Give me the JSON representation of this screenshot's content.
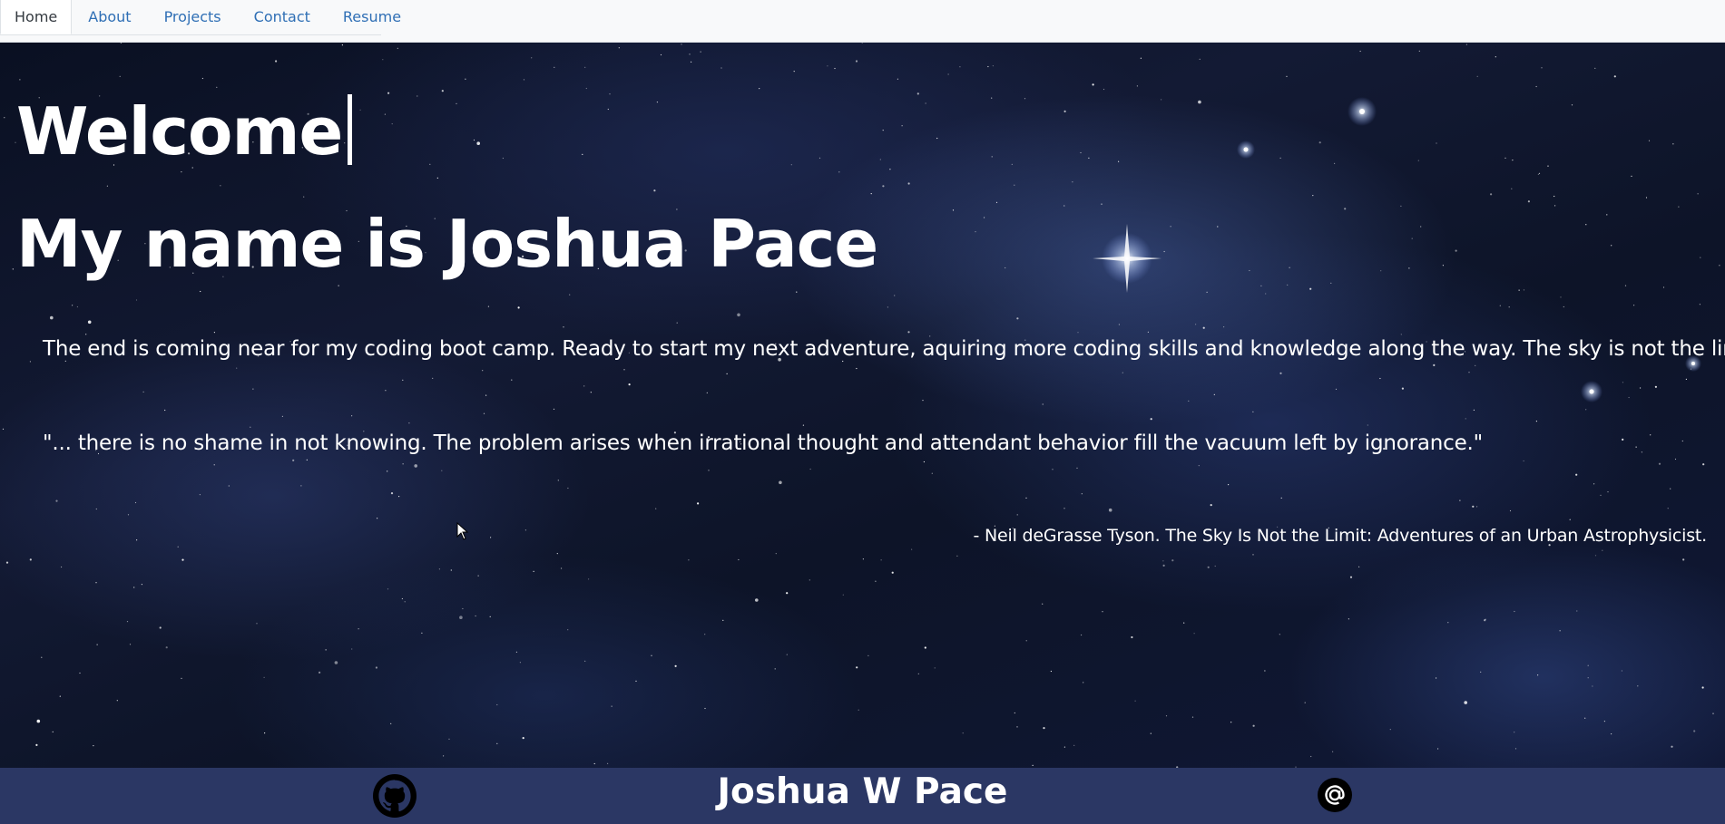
{
  "nav": {
    "tabs": [
      {
        "label": "Home",
        "active": true
      },
      {
        "label": "About"
      },
      {
        "label": "Projects"
      },
      {
        "label": "Contact"
      },
      {
        "label": "Resume"
      }
    ]
  },
  "hero": {
    "welcome": "Welcome",
    "name_heading": "My name is Joshua Pace",
    "intro": "The end is coming near for my coding boot camp. Ready to start my next adventure, aquiring more coding skills and knowledge along the way. The sky is not the limit!",
    "quote": "\"... there is no shame in not knowing. The problem arises when irrational thought and attendant behavior fill the vacuum left by ignorance.\"",
    "attribution": "- Neil deGrasse Tyson. The Sky Is Not the Limit: Adventures of an Urban Astrophysicist."
  },
  "footer": {
    "name": "Joshua W Pace",
    "left_icon": "github-icon",
    "right_icon": "email-at-icon"
  },
  "colors": {
    "nav_link": "#2f6fb5",
    "nav_active": "#343a40",
    "footer_bg": "#2b3764",
    "text": "#ffffff"
  }
}
